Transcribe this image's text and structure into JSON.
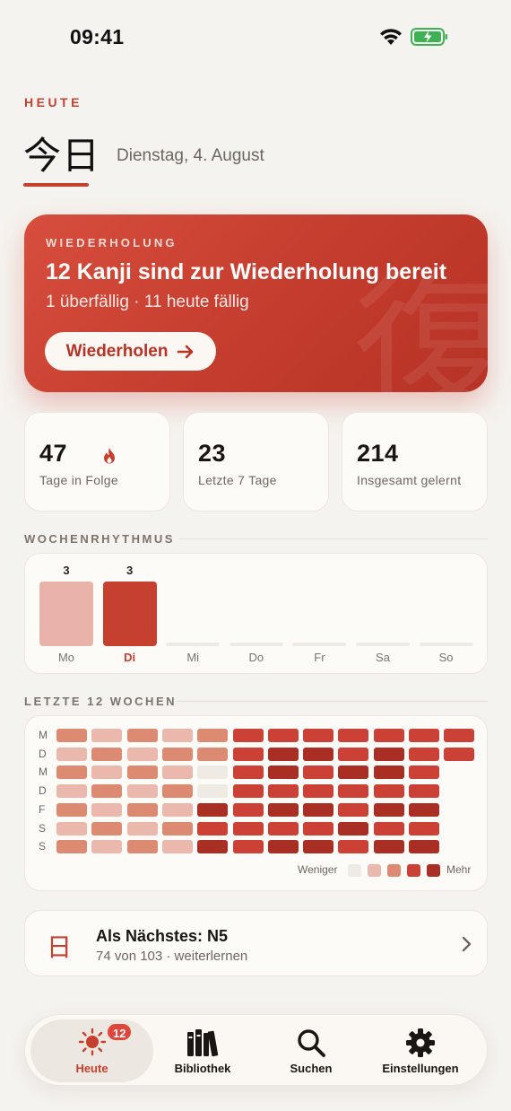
{
  "status": {
    "time": "09:41"
  },
  "header": {
    "eyebrow": "HEUTE",
    "kanji": "今日",
    "date": "Dienstag, 4. August"
  },
  "hero": {
    "label": "WIEDERHOLUNG",
    "title": "12 Kanji sind zur Wiederholung bereit",
    "subtitle": "1 überfällig · 11 heute fällig",
    "button_label": "Wiederholen",
    "watermark": "復"
  },
  "stats": [
    {
      "value": "47",
      "caption": "Tage in Folge",
      "icon": "flame-icon"
    },
    {
      "value": "23",
      "caption": "Letzte 7 Tage"
    },
    {
      "value": "214",
      "caption": "Insgesamt gelernt"
    }
  ],
  "weekly": {
    "heading": "WOCHENRHYTHMUS",
    "days": [
      {
        "label": "Mo",
        "value": 3,
        "value_label": "3",
        "today": false
      },
      {
        "label": "Di",
        "value": 3,
        "value_label": "3",
        "today": true
      },
      {
        "label": "Mi",
        "value": 0,
        "value_label": "",
        "today": false
      },
      {
        "label": "Do",
        "value": 0,
        "value_label": "",
        "today": false
      },
      {
        "label": "Fr",
        "value": 0,
        "value_label": "",
        "today": false
      },
      {
        "label": "Sa",
        "value": 0,
        "value_label": "",
        "today": false
      },
      {
        "label": "So",
        "value": 0,
        "value_label": "",
        "today": false
      }
    ]
  },
  "heatmap": {
    "heading": "LETZTE 12 WOCHEN",
    "row_labels": [
      "M",
      "D",
      "M",
      "D",
      "F",
      "S",
      "S"
    ],
    "levels": [
      [
        2,
        1,
        2,
        1,
        2,
        3,
        3,
        3,
        3,
        3,
        3,
        3
      ],
      [
        1,
        2,
        1,
        2,
        2,
        3,
        4,
        4,
        3,
        4,
        3,
        3
      ],
      [
        2,
        1,
        2,
        1,
        0,
        3,
        4,
        3,
        4,
        4,
        3,
        -1
      ],
      [
        1,
        2,
        1,
        2,
        0,
        3,
        3,
        3,
        3,
        3,
        3,
        -1
      ],
      [
        2,
        1,
        2,
        1,
        4,
        3,
        4,
        4,
        3,
        4,
        4,
        -1
      ],
      [
        1,
        2,
        1,
        2,
        3,
        3,
        3,
        3,
        4,
        3,
        3,
        -1
      ],
      [
        2,
        1,
        2,
        1,
        4,
        3,
        4,
        4,
        3,
        4,
        4,
        -1
      ]
    ],
    "legend_less": "Weniger",
    "legend_more": "Mehr",
    "colors": [
      "#EFEBE4",
      "#EAB8AC",
      "#DD8A72",
      "#CC4136",
      "#A92F25"
    ]
  },
  "next": {
    "kanji": "日",
    "title": "Als Nächstes: N5",
    "subtitle": "74 von 103 · weiterlernen"
  },
  "tabbar": {
    "tabs": [
      {
        "label": "Heute",
        "icon": "sun-icon",
        "active": true,
        "badge": "12"
      },
      {
        "label": "Bibliothek",
        "icon": "books-icon",
        "active": false
      },
      {
        "label": "Suchen",
        "icon": "search-icon",
        "active": false
      },
      {
        "label": "Einstellungen",
        "icon": "gear-icon",
        "active": false
      }
    ]
  },
  "accent": "#C6402F"
}
